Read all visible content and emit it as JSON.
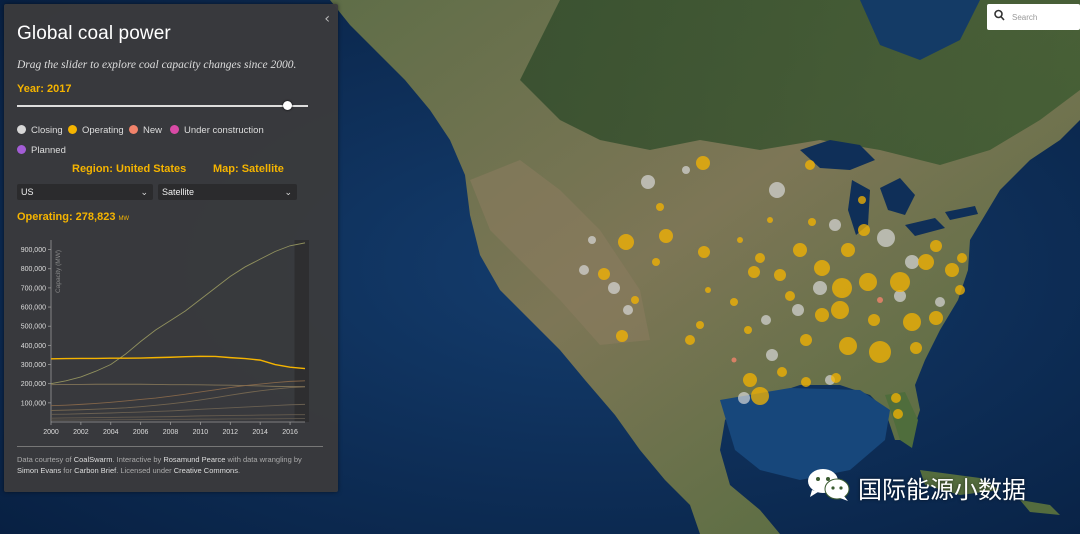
{
  "panel": {
    "title": "Global coal power",
    "subtitle": "Drag the slider to explore coal capacity changes since 2000.",
    "year_label": "Year: 2017",
    "slider": {
      "min": 2000,
      "max": 2017,
      "value": 2017
    },
    "legend": [
      {
        "label": "Closing",
        "color": "#d7d7d7"
      },
      {
        "label": "Operating",
        "color": "#f5b400"
      },
      {
        "label": "New",
        "color": "#f2836b"
      },
      {
        "label": "Under construction",
        "color": "#d94aa6"
      },
      {
        "label": "Planned",
        "color": "#a35dd6"
      }
    ],
    "region_header": "Region: United States",
    "map_header": "Map: Satellite",
    "region_select": "US",
    "map_select": "Satellite",
    "operating_label": "Operating: 278,823",
    "operating_unit": "MW",
    "credits": {
      "t1": "Data courtesy of ",
      "l1": "CoalSwarm",
      "t2": ". Interactive by ",
      "l2": "Rosamund Pearce",
      "t3": " with data wrangling by ",
      "l3": "Simon Evans",
      "t4": " for ",
      "l4": "Carbon Brief",
      "t5": ". Licensed under ",
      "l5": "Creative Commons",
      "t6": "."
    }
  },
  "collapse_icon": "chevron-left-icon",
  "search": {
    "placeholder": "Search",
    "icon": "search-icon"
  },
  "watermark": {
    "text": "国际能源小数据",
    "icon": "wechat-icon"
  },
  "chart_data": {
    "type": "line",
    "ylabel": "Capacity (MW)",
    "x": [
      2000,
      2001,
      2002,
      2003,
      2004,
      2005,
      2006,
      2007,
      2008,
      2009,
      2010,
      2011,
      2012,
      2013,
      2014,
      2015,
      2016,
      2017
    ],
    "xticks": [
      "2000",
      "2002",
      "2004",
      "2006",
      "2008",
      "2010",
      "2012",
      "2014",
      "2016"
    ],
    "yticks": [
      "100,000",
      "200,000",
      "300,000",
      "400,000",
      "500,000",
      "600,000",
      "700,000",
      "800,000",
      "900,000"
    ],
    "ylim": [
      0,
      950000
    ],
    "xlim": [
      2000,
      2017
    ],
    "highlight_range": [
      2016.5,
      2017
    ],
    "series": [
      {
        "color": "#9a9a62",
        "values": [
          200000,
          215000,
          235000,
          265000,
          300000,
          355000,
          420000,
          480000,
          530000,
          580000,
          640000,
          700000,
          760000,
          810000,
          850000,
          890000,
          920000,
          935000
        ]
      },
      {
        "color": "#f5b400",
        "values": [
          330000,
          331000,
          332000,
          332000,
          333000,
          333000,
          334000,
          336000,
          338000,
          341000,
          343000,
          342000,
          336000,
          331000,
          323000,
          300000,
          286000,
          279000
        ]
      },
      {
        "color": "#8a7a5a",
        "values": [
          195000,
          196000,
          196000,
          197000,
          197000,
          197000,
          197000,
          196000,
          195000,
          195000,
          194000,
          193000,
          192000,
          190000,
          188000,
          186000,
          185000,
          185000
        ]
      },
      {
        "color": "#8c6a4a",
        "values": [
          85000,
          88000,
          92000,
          97000,
          103000,
          110000,
          118000,
          125000,
          135000,
          145000,
          157000,
          168000,
          180000,
          190000,
          198000,
          206000,
          212000,
          215000
        ]
      },
      {
        "color": "#7a6a52",
        "values": [
          60000,
          62000,
          64000,
          67000,
          70000,
          74000,
          80000,
          87000,
          95000,
          104000,
          115000,
          127000,
          140000,
          152000,
          163000,
          172000,
          180000,
          183000
        ]
      },
      {
        "color": "#6f6453",
        "values": [
          40000,
          41000,
          43000,
          45000,
          47000,
          50000,
          52000,
          55000,
          58000,
          62000,
          66000,
          70000,
          74000,
          78000,
          82000,
          86000,
          90000,
          92000
        ]
      },
      {
        "color": "#6a5f50",
        "values": [
          20000,
          21000,
          22000,
          23000,
          24000,
          25000,
          26000,
          27000,
          28000,
          30000,
          32000,
          33000,
          34000,
          35000,
          36000,
          37000,
          38000,
          38000
        ]
      },
      {
        "color": "#625a4f",
        "values": [
          10000,
          10000,
          11000,
          11000,
          12000,
          12000,
          13000,
          13000,
          14000,
          14000,
          15000,
          15000,
          16000,
          16000,
          17000,
          17000,
          18000,
          18000
        ]
      }
    ]
  }
}
